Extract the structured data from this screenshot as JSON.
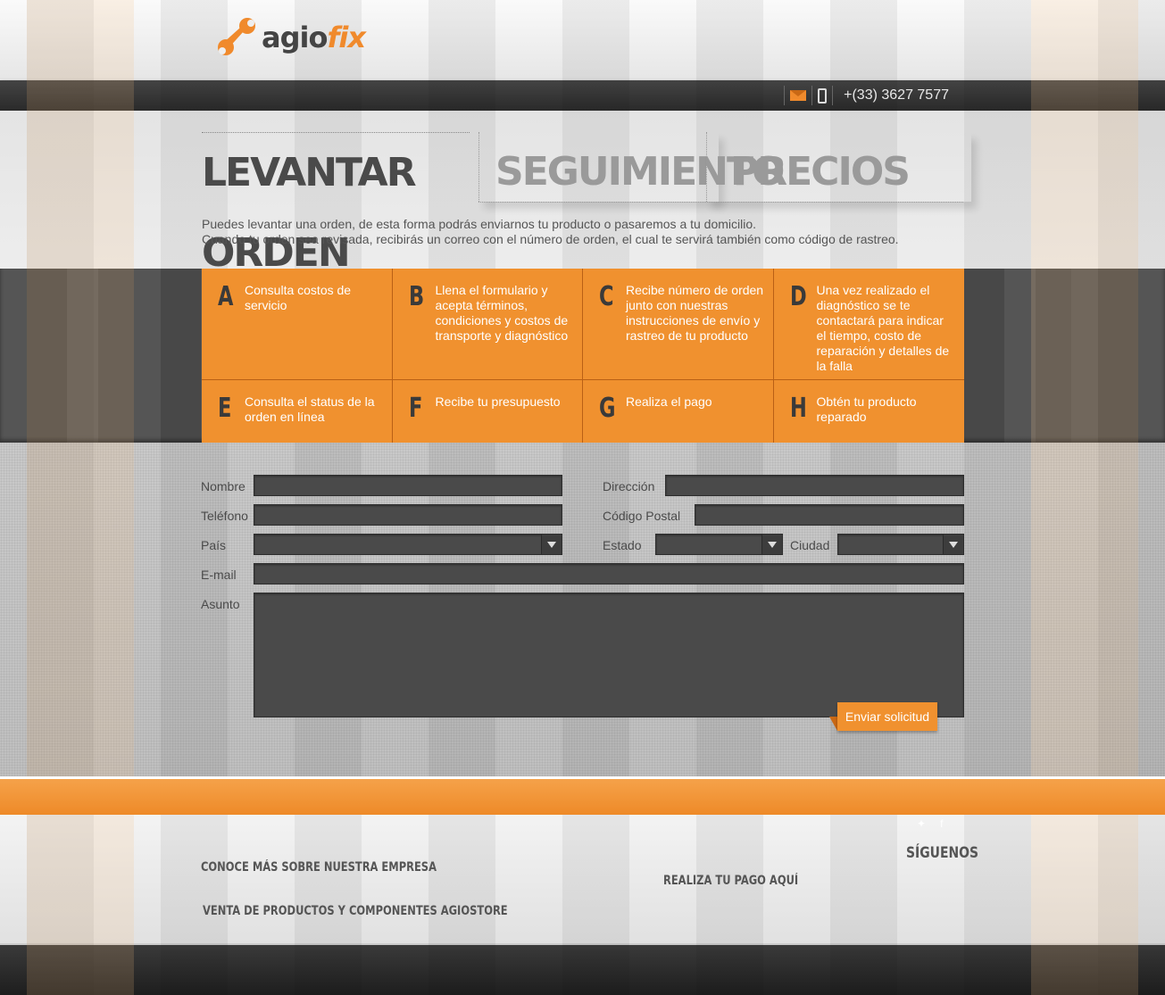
{
  "brand": {
    "name_part1": "agio",
    "name_part2": "fix",
    "accent": "#f08a2c"
  },
  "contact": {
    "mail_icon": "mail-icon",
    "phone_icon": "mobile-phone-icon",
    "phone": "+(33) 3627 7577"
  },
  "tabs": [
    {
      "label": "LEVANTAR ORDEN",
      "active": true
    },
    {
      "label": "SEGUIMIENTO",
      "active": false
    },
    {
      "label": "PRECIOS",
      "active": false
    }
  ],
  "intro": {
    "line1": "Puedes levantar una orden, de esta forma podrás enviarnos tu producto o pasaremos a tu domicilio.",
    "line2": "Cuando tu orden sea revisada, recibirás un correo con el número de orden, el cual te servirá también como código de rastreo."
  },
  "steps": [
    {
      "letter": "A",
      "text": "Consulta costos de servicio"
    },
    {
      "letter": "B",
      "text": "Llena el formulario y acepta términos, condiciones y costos de transporte y diagnóstico"
    },
    {
      "letter": "C",
      "text": "Recibe número de orden junto con nuestras instrucciones de envío y rastreo de tu producto"
    },
    {
      "letter": "D",
      "text": "Una vez realizado el diagnóstico se te contactará para indicar el tiempo, costo de reparación y detalles de la falla"
    },
    {
      "letter": "E",
      "text": "Consulta el status de la orden en línea"
    },
    {
      "letter": "F",
      "text": "Recibe tu presupuesto"
    },
    {
      "letter": "G",
      "text": "Realiza el pago"
    },
    {
      "letter": "H",
      "text": "Obtén tu producto reparado"
    }
  ],
  "form": {
    "nombre": {
      "label": "Nombre",
      "value": ""
    },
    "telefono": {
      "label": "Teléfono",
      "value": ""
    },
    "pais": {
      "label": "País",
      "value": ""
    },
    "email": {
      "label": "E-mail",
      "value": ""
    },
    "asunto": {
      "label": "Asunto",
      "value": ""
    },
    "direccion": {
      "label": "Dirección",
      "value": ""
    },
    "codigo_postal": {
      "label": "Código Postal",
      "value": ""
    },
    "estado": {
      "label": "Estado",
      "value": ""
    },
    "ciudad": {
      "label": "Ciudad",
      "value": ""
    },
    "submit": "Enviar solicitud"
  },
  "footer": {
    "link1": "CONOCE MÁS SOBRE NUESTRA EMPRESA",
    "link2": "VENTA DE PRODUCTOS Y COMPONENTES AGIOSTORE",
    "link3": "REALIZA TU PAGO AQUÍ",
    "follow": "SÍGUENOS",
    "social_icons": [
      "twitter-icon",
      "facebook-icon"
    ]
  }
}
